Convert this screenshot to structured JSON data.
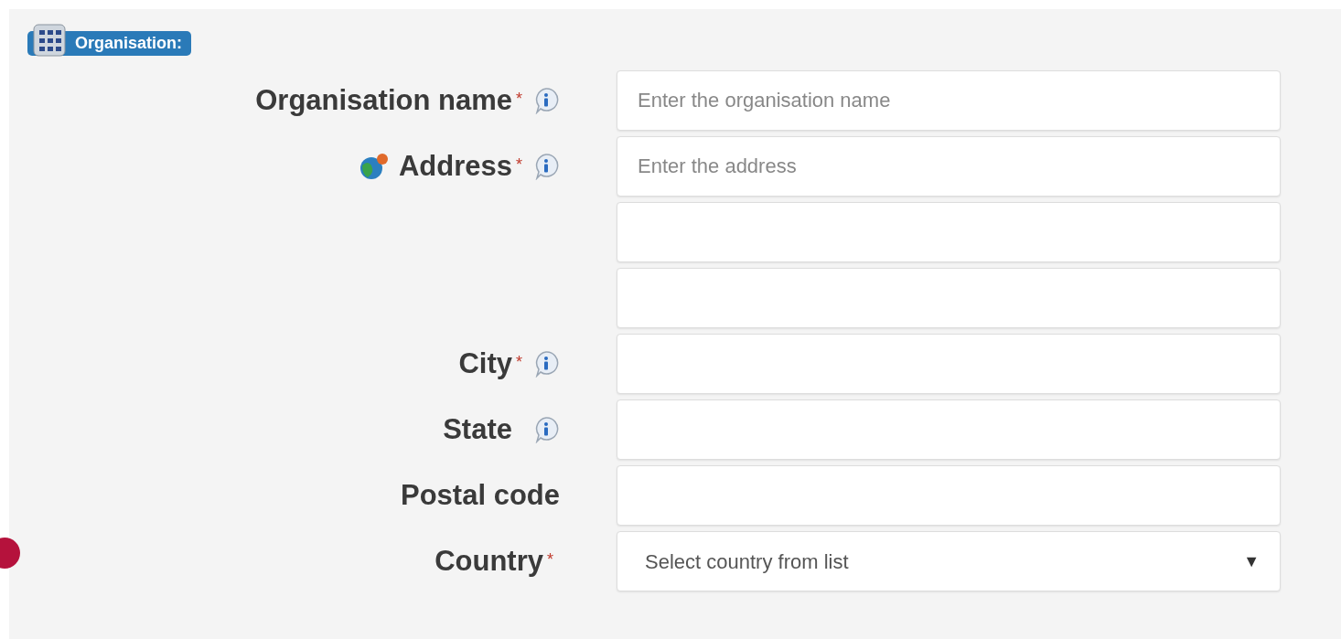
{
  "section": {
    "title": "Organisation:"
  },
  "rows": [
    {
      "label": "Organisation name",
      "required": true,
      "info": true,
      "locate": false,
      "inputs": [
        {
          "kind": "text",
          "placeholder": "Enter the organisation name"
        }
      ]
    },
    {
      "label": "Address",
      "required": true,
      "info": true,
      "locate": true,
      "inputs": [
        {
          "kind": "text",
          "placeholder": "Enter the address"
        },
        {
          "kind": "text"
        },
        {
          "kind": "text"
        }
      ]
    },
    {
      "label": "City",
      "required": true,
      "info": true,
      "locate": false,
      "inputs": [
        {
          "kind": "text"
        }
      ]
    },
    {
      "label": "State",
      "required": false,
      "info": true,
      "locate": false,
      "inputs": [
        {
          "kind": "text"
        }
      ]
    },
    {
      "label": "Postal code",
      "required": false,
      "info": false,
      "locate": false,
      "inputs": [
        {
          "kind": "text"
        }
      ]
    },
    {
      "label": "Country",
      "required": true,
      "info": false,
      "locate": false,
      "inputs": [
        {
          "kind": "select",
          "value": "Select country from list",
          "caret": "▼"
        }
      ]
    }
  ],
  "required_mark": "*"
}
